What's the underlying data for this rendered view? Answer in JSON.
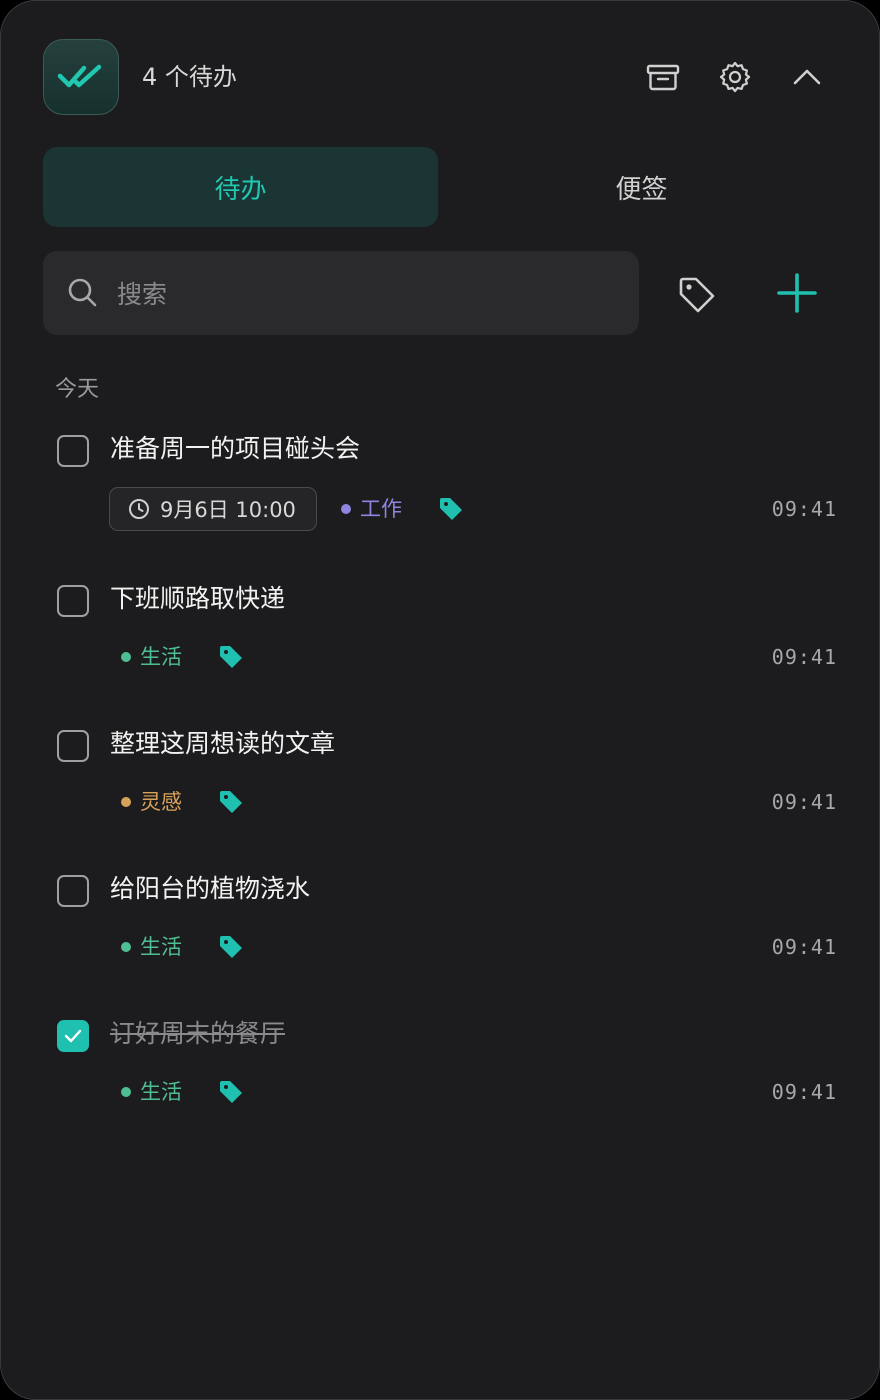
{
  "header": {
    "app_icon": "double-check-icon",
    "count_text": "4 个待办",
    "actions": [
      "archive-icon",
      "gear-icon",
      "chevron-up-icon"
    ]
  },
  "tabs": [
    {
      "label": "待办",
      "active": true
    },
    {
      "label": "便签",
      "active": false
    }
  ],
  "search": {
    "placeholder": "搜索",
    "value": ""
  },
  "colors": {
    "accent": "#1fc0b0",
    "work": "#8e86de",
    "life": "#4fbf93",
    "inspiration": "#d9a25a",
    "background": "#1c1c1e"
  },
  "section": {
    "label": "今天"
  },
  "items": [
    {
      "title": "准备周一的项目碰头会",
      "done": false,
      "due": "9月6日 10:00",
      "label": "工作",
      "time": "09:41"
    },
    {
      "title": "下班顺路取快递",
      "done": false,
      "label": "生活",
      "time": "09:41"
    },
    {
      "title": "整理这周想读的文章",
      "done": false,
      "label": "灵感",
      "time": "09:41"
    },
    {
      "title": "给阳台的植物浇水",
      "done": false,
      "label": "生活",
      "time": "09:41"
    },
    {
      "title": "订好周末的餐厅",
      "done": true,
      "label": "生活",
      "time": "09:41"
    }
  ]
}
